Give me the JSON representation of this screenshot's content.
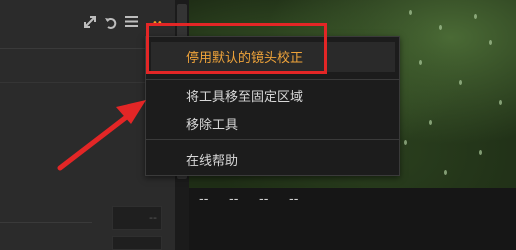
{
  "menu": {
    "items": [
      {
        "label": "停用默认的镜头校正",
        "highlight": true
      },
      {
        "label": "将工具移至固定区域",
        "highlight": false
      },
      {
        "label": "移除工具",
        "highlight": false
      },
      {
        "label": "在线帮助",
        "highlight": false
      }
    ]
  },
  "panel": {
    "value_placeholder": "--"
  },
  "image_info": {
    "coords": [
      "--",
      "--",
      "--",
      "--"
    ]
  },
  "toolbar": {
    "icons": [
      "expand-icon",
      "reset-icon",
      "menu-icon",
      "more-dots-icon"
    ]
  },
  "colors": {
    "annotation": "#e32626",
    "highlight_text": "#f0a43a"
  }
}
